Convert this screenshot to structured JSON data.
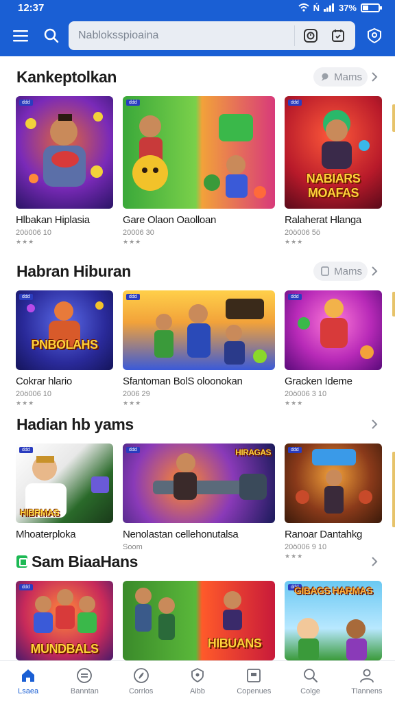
{
  "status_bar": {
    "time": "12:37",
    "signal_text": "Ń",
    "battery_text": "37%",
    "battery_level": 0.37
  },
  "app_bar": {
    "search_placeholder": "Nabloksspioaina",
    "icons": [
      "menu-icon",
      "search-icon",
      "clock-icon",
      "calendar-icon",
      "profile-icon"
    ],
    "accent": "#1a5fd4"
  },
  "sections": [
    {
      "title": "Kankeptolkan",
      "more_label": "Mams",
      "cards": [
        {
          "name": "Hlbakan Hiplasia",
          "meta": "20ö006 10",
          "stars": "★★★",
          "thumb_tag": "ddd",
          "thumb_title": ""
        },
        {
          "name": "Gare Olaon Oaolloan",
          "meta": "20006 30",
          "stars": "★★★",
          "thumb_tag": "ddd",
          "thumb_title": ""
        },
        {
          "name": "Ralaherat Hlanga",
          "meta": "20ö006 5ö",
          "stars": "★★★",
          "thumb_tag": "ddd",
          "thumb_title": "NABIARS MOAFAS"
        }
      ]
    },
    {
      "title": "Habran Hiburan",
      "more_label": "Mams",
      "cards": [
        {
          "name": "Cokrar hlario",
          "meta": "20ö006 10",
          "stars": "★★★",
          "thumb_tag": "ddd",
          "thumb_title": "PNBOLAHS"
        },
        {
          "name": "Sfantoman BolS oloonokan",
          "meta": "2006 29",
          "stars": "★★★",
          "thumb_tag": "ddd",
          "thumb_title": ""
        },
        {
          "name": "Gracken Ideme",
          "meta": "20ö006 3 10",
          "stars": "★★★",
          "thumb_tag": "ddd",
          "thumb_title": ""
        }
      ]
    },
    {
      "title": "Hadian hb yams",
      "more_label": "",
      "cards": [
        {
          "name": "Mhoaterploka",
          "meta": "",
          "stars": "",
          "thumb_tag": "ddd",
          "thumb_title": "HIBRMAS"
        },
        {
          "name": "Nenolastan cellehonutalsa",
          "meta": "Soom",
          "stars": "",
          "thumb_tag": "ddd",
          "thumb_title": "HIRAGAS"
        },
        {
          "name": "Ranoar Dantahkg",
          "meta": "20ö006 9 10",
          "stars": "★★★",
          "thumb_tag": "ddd",
          "thumb_title": ""
        }
      ]
    },
    {
      "title": "Sam BiaaHans",
      "more_label": "",
      "cards": [
        {
          "name": "",
          "meta": "",
          "stars": "",
          "thumb_tag": "ddd",
          "thumb_title": "MUNDBALS"
        },
        {
          "name": "",
          "meta": "",
          "stars": "",
          "thumb_tag": "",
          "thumb_title": "HIBUANS"
        },
        {
          "name": "",
          "meta": "",
          "stars": "",
          "thumb_tag": "ddd",
          "thumb_title": "GIBAGS HARMAS"
        }
      ]
    }
  ],
  "bottom_nav": [
    {
      "label": "Lsaea",
      "icon": "home-icon",
      "active": true
    },
    {
      "label": "Banntan",
      "icon": "list-icon",
      "active": false
    },
    {
      "label": "Corrlos",
      "icon": "compass-icon",
      "active": false
    },
    {
      "label": "Aibb",
      "icon": "shield-icon",
      "active": false
    },
    {
      "label": "Copenues",
      "icon": "window-icon",
      "active": false
    },
    {
      "label": "Colge",
      "icon": "search-icon",
      "active": false
    },
    {
      "label": "Tlannens",
      "icon": "person-icon",
      "active": false
    }
  ]
}
